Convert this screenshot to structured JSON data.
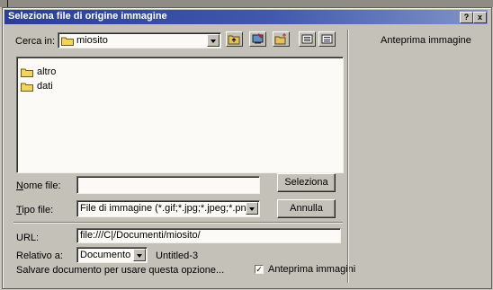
{
  "window": {
    "title": "Seleziona file di origine immagine",
    "help_label": "?",
    "close_label": "x"
  },
  "toolbar": {
    "look_in_label": "Cerca in:",
    "look_in_value": "miosito",
    "icons": [
      "folder-up-icon",
      "desktop-icon",
      "new-folder-icon",
      "list-view-icon",
      "details-view-icon"
    ]
  },
  "files": [
    {
      "name": "altro",
      "icon": "folder-icon"
    },
    {
      "name": "dati",
      "icon": "folder-icon"
    }
  ],
  "form": {
    "filename_label": "Nome file:",
    "filename_value": "",
    "filetype_label": "Tipo file:",
    "filetype_value": "File di immagine (*.gif;*.jpg;*.jpeg;*.png)",
    "url_label": "URL:",
    "url_value": "file:///C|/Documenti/miosito/",
    "relative_label": "Relativo a:",
    "relative_value": "Documento",
    "relative_doc": "Untitled-3",
    "note": "Salvare documento per usare questa opzione..."
  },
  "buttons": {
    "select": "Seleziona",
    "cancel": "Annulla"
  },
  "preview": {
    "title": "Anteprima immagine",
    "checkbox_label": "Anteprima immagini",
    "checked": true,
    "check_mark": "✓"
  },
  "colors": {
    "titlebar": "#2a3e97",
    "dialog": "#c4c1b8",
    "folder": "#f2d35b"
  }
}
